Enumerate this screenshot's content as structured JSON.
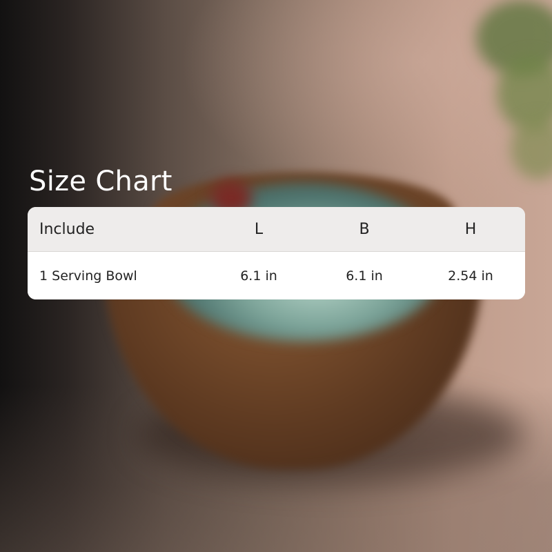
{
  "title": "Size Chart",
  "table": {
    "headers": [
      "Include",
      "L",
      "B",
      "H"
    ],
    "rows": [
      [
        "1 Serving Bowl",
        "6.1 in",
        "6.1 in",
        "2.54 in"
      ]
    ]
  },
  "colors": {
    "card_header_bg": "#eeeceb",
    "card_body_bg": "#ffffff",
    "title_text": "#ffffff",
    "cell_text": "#222222"
  }
}
